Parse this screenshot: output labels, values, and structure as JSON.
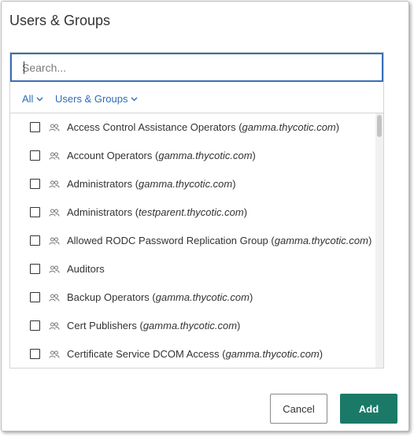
{
  "dialog": {
    "title": "Users & Groups"
  },
  "search": {
    "placeholder": "Search...",
    "value": ""
  },
  "filters": {
    "scope_label": "All",
    "type_label": "Users & Groups"
  },
  "items": [
    {
      "name": "Access Control Assistance Operators",
      "domain": "gamma.thycotic.com",
      "checked": false,
      "icon": "group-icon"
    },
    {
      "name": "Account Operators",
      "domain": "gamma.thycotic.com",
      "checked": false,
      "icon": "group-icon"
    },
    {
      "name": "Administrators",
      "domain": "gamma.thycotic.com",
      "checked": false,
      "icon": "group-icon"
    },
    {
      "name": "Administrators",
      "domain": "testparent.thycotic.com",
      "checked": false,
      "icon": "group-icon"
    },
    {
      "name": "Allowed RODC Password Replication Group",
      "domain": "gamma.thycotic.com",
      "checked": false,
      "icon": "group-icon"
    },
    {
      "name": "Auditors",
      "domain": "",
      "checked": false,
      "icon": "group-icon"
    },
    {
      "name": "Backup Operators",
      "domain": "gamma.thycotic.com",
      "checked": false,
      "icon": "group-icon"
    },
    {
      "name": "Cert Publishers",
      "domain": "gamma.thycotic.com",
      "checked": false,
      "icon": "group-icon"
    },
    {
      "name": "Certificate Service DCOM Access",
      "domain": "gamma.thycotic.com",
      "checked": false,
      "icon": "group-icon"
    }
  ],
  "footer": {
    "cancel_label": "Cancel",
    "add_label": "Add"
  },
  "colors": {
    "accent": "#2e6db4",
    "search_border": "#3a6fb6",
    "primary_button": "#1a7a67"
  }
}
